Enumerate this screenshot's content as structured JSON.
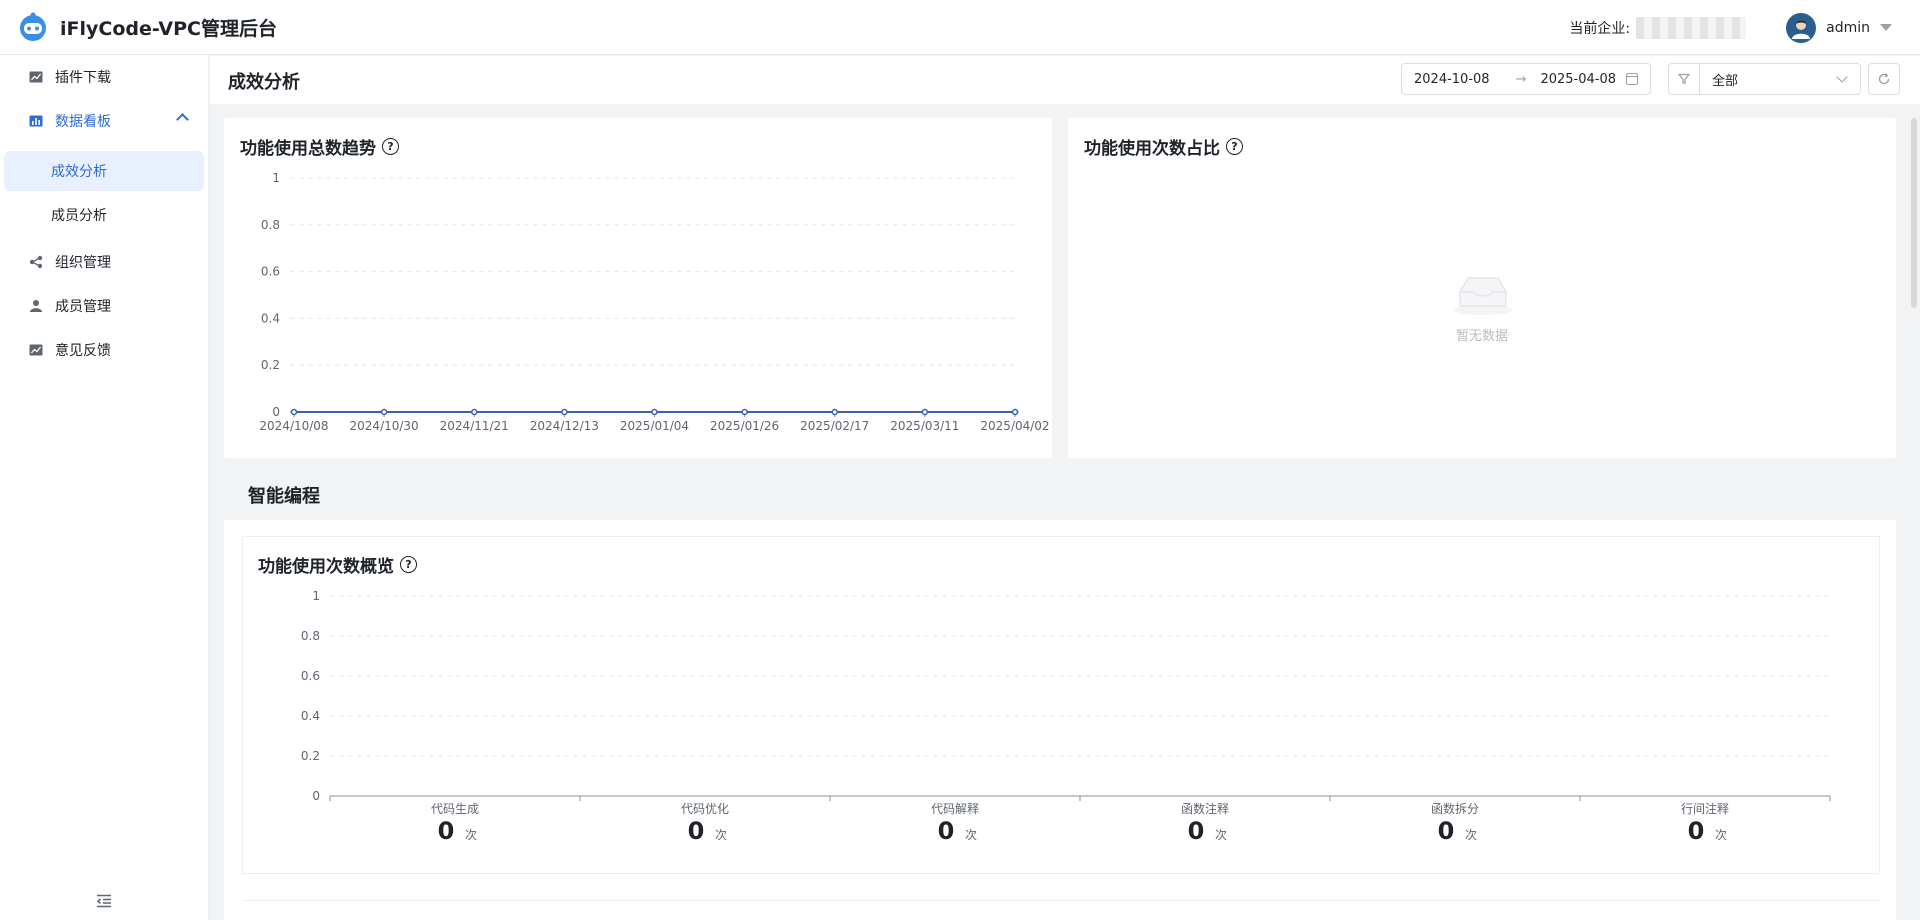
{
  "header": {
    "app_title": "iFlyCode-VPC管理后台",
    "enterprise_label": "当前企业:",
    "user_name": "admin"
  },
  "sidebar": {
    "items": [
      {
        "label": "插件下载",
        "icon": "line-chart-icon"
      },
      {
        "label": "数据看板",
        "icon": "bar-chart-icon"
      },
      {
        "label": "成效分析"
      },
      {
        "label": "成员分析"
      },
      {
        "label": "组织管理",
        "icon": "share-nodes-icon"
      },
      {
        "label": "成员管理",
        "icon": "user-icon"
      },
      {
        "label": "意见反馈",
        "icon": "line-chart-icon"
      }
    ]
  },
  "toolbar": {
    "page_title": "成效分析",
    "date_start": "2024-10-08",
    "date_end": "2025-04-08",
    "date_separator": "→",
    "filter_value": "全部"
  },
  "trend_card": {
    "title": "功能使用总数趋势",
    "help": "?"
  },
  "ratio_card": {
    "title": "功能使用次数占比",
    "help": "?",
    "empty_text": "暂无数据"
  },
  "section": {
    "title": "智能编程"
  },
  "overview_card": {
    "title": "功能使用次数概览",
    "help": "?",
    "unit": "次"
  },
  "colors": {
    "primary": "#2f6bd6",
    "line": "#3a5fb8"
  },
  "chart_data": [
    {
      "type": "line",
      "title": "功能使用总数趋势",
      "x": [
        "2024/10/08",
        "2024/10/30",
        "2024/11/21",
        "2024/12/13",
        "2025/01/04",
        "2025/01/26",
        "2025/02/17",
        "2025/03/11",
        "2025/04/02"
      ],
      "series": [
        {
          "values": [
            0,
            0,
            0,
            0,
            0,
            0,
            0,
            0,
            0
          ]
        }
      ],
      "ylim": [
        0,
        1
      ],
      "yticks": [
        "0",
        "0.2",
        "0.4",
        "0.6",
        "0.8",
        "1"
      ],
      "grid": true
    },
    {
      "type": "bar",
      "title": "功能使用次数概览",
      "categories": [
        "代码生成",
        "代码优化",
        "代码解释",
        "函数注释",
        "函数拆分",
        "行间注释"
      ],
      "values": [
        0,
        0,
        0,
        0,
        0,
        0
      ],
      "ylim": [
        0,
        1
      ],
      "yticks": [
        "0",
        "0.2",
        "0.4",
        "0.6",
        "0.8",
        "1"
      ],
      "grid": true
    }
  ]
}
